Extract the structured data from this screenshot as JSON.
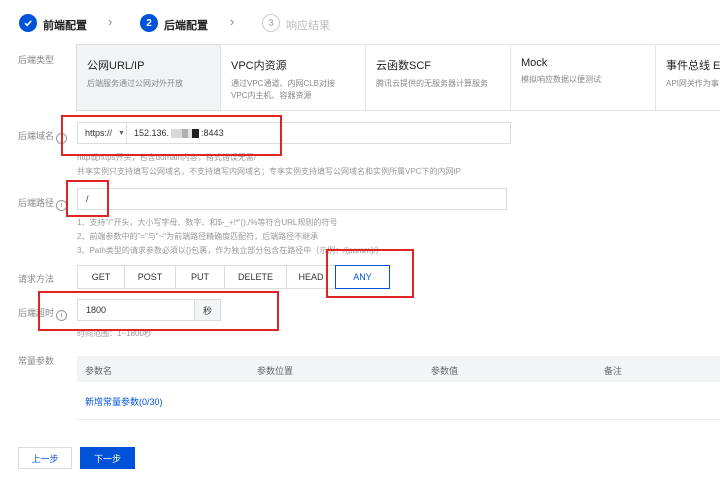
{
  "steps": [
    {
      "label": "前端配置",
      "state": "done"
    },
    {
      "number": "2",
      "label": "后端配置",
      "state": "active"
    },
    {
      "number": "3",
      "label": "响应结果",
      "state": "todo"
    }
  ],
  "backend_type": {
    "label": "后端类型",
    "cards": [
      {
        "title": "公网URL/IP",
        "desc1": "后端服务通过公网对外开放",
        "desc2": ""
      },
      {
        "title": "VPC内资源",
        "desc1": "通过VPC通道、内网CLB对接",
        "desc2": "VPC内主机、容器资源"
      },
      {
        "title": "云函数SCF",
        "desc1": "腾讯云提供的无服务器计算服务",
        "desc2": ""
      },
      {
        "title": "Mock",
        "desc1": "模拟响应数据以便测试",
        "desc2": ""
      },
      {
        "title": "事件总线 Ev",
        "desc1": "API网关作为事",
        "desc2": ""
      }
    ]
  },
  "backend_domain": {
    "label": "后端域名",
    "protocol": "https://",
    "value_prefix": "152.136.",
    "value_suffix": ":8443",
    "help1": "http或https开头，包含domain内容，格式错误无需/",
    "help2": "共享实例只支持填写公网域名，不支持填写内网域名；专享实例支持填写公网域名和实例所属VPC下的内网IP"
  },
  "backend_path": {
    "label": "后端路径",
    "value": "/",
    "help1": "1、支持\"/\"开头，大小写字母、数字、和$-_+!*'(),/%等符合URL规则的符号",
    "help2": "2、前端参数中的\"=\"与\"~\"为前端路径精确度匹配符，后端路径不继承",
    "help3": "3、Path类型的请求参数必须以{}包裹，作为独立部分包含在路径中（示例：/{param}/）"
  },
  "method": {
    "label": "请求方法",
    "options": [
      "GET",
      "POST",
      "PUT",
      "DELETE",
      "HEAD",
      "ANY"
    ],
    "selected": "ANY"
  },
  "timeout": {
    "label": "后端超时",
    "value": "1800",
    "unit": "秒",
    "help": "时间范围：1~1800秒"
  },
  "constants": {
    "label": "常量参数",
    "columns": [
      "参数名",
      "参数位置",
      "参数值",
      "备注"
    ],
    "add_link": "新增常量参数(0/30)"
  },
  "footer": {
    "prev": "上一步",
    "next": "下一步"
  },
  "colors": {
    "primary": "#0052d9",
    "annotation": "#e02424"
  }
}
